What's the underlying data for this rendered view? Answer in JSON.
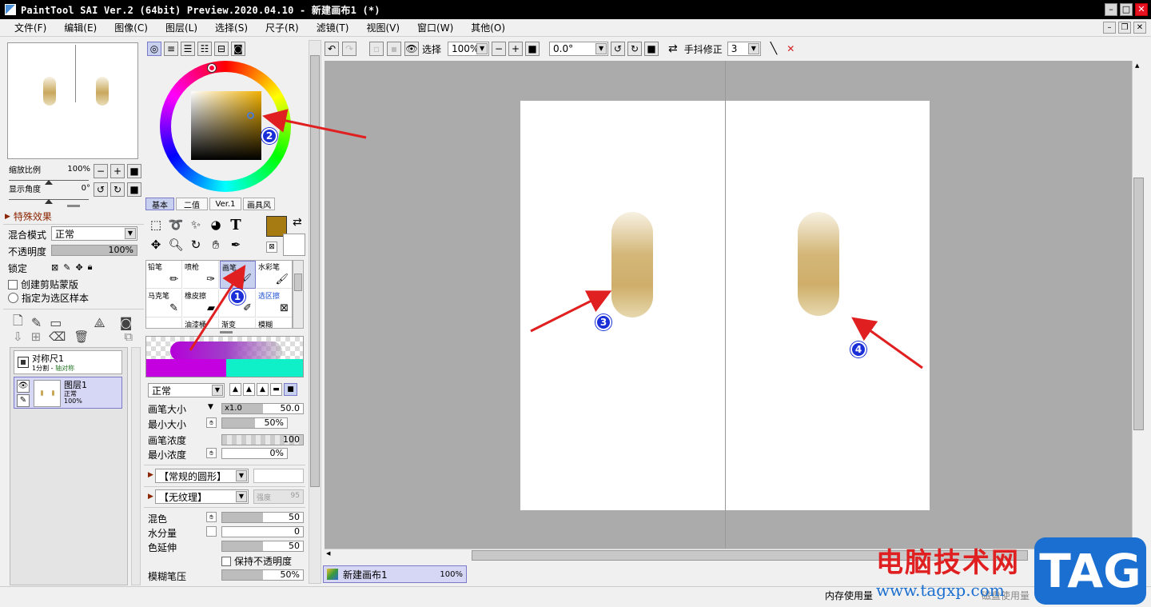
{
  "window": {
    "title": "PaintTool SAI Ver.2 (64bit) Preview.2020.04.10 - 新建画布1 (*)"
  },
  "menu": [
    "文件(F)",
    "编辑(E)",
    "图像(C)",
    "图层(L)",
    "选择(S)",
    "尺子(R)",
    "滤镜(T)",
    "视图(V)",
    "窗口(W)",
    "其他(O)"
  ],
  "navigator": {
    "zoom_label": "缩放比例",
    "zoom_value": "100%",
    "zoom_fraction": 0.5,
    "angle_label": "显示角度",
    "angle_value": "0°",
    "angle_fraction": 0.5
  },
  "effects": {
    "title": "特殊效果",
    "blend_label": "混合模式",
    "blend_value": "正常",
    "opacity_label": "不透明度",
    "opacity_value": "100%",
    "opacity_fraction": 1.0,
    "lock_label": "锁定",
    "clip_label": "创建剪贴蒙版",
    "sample_label": "指定为选区样本"
  },
  "layers": [
    {
      "name": "对称尺1",
      "sub1": "1分割",
      "sub2": "轴对称",
      "selected": false
    },
    {
      "name": "图层1",
      "mode": "正常",
      "opacity": "100%",
      "selected": true
    }
  ],
  "color": {
    "tabs": [
      "基本",
      "二值",
      "Ver.1",
      "画具风"
    ],
    "primary": "#a57b12",
    "secondary": "#ffffff"
  },
  "brushes": {
    "row1": [
      "铅笔",
      "喷枪",
      "画笔",
      "水彩笔"
    ],
    "row2": [
      "马克笔",
      "橡皮擦",
      "",
      "选区擦"
    ],
    "row3": [
      "",
      "油漆桶",
      "渐变",
      "模糊"
    ]
  },
  "brush_settings": {
    "mode": "正常",
    "size_label": "画笔大小",
    "size_mult": "x1.0",
    "size_value": "50.0",
    "size_fraction": 0.5,
    "min_size_label": "最小大小",
    "min_size_value": "50%",
    "min_size_fraction": 0.5,
    "density_label": "画笔浓度",
    "density_value": "100",
    "density_fraction": 1.0,
    "min_density_label": "最小浓度",
    "min_density_value": "0%",
    "min_density_fraction": 0.0,
    "shape": "【常规的圆形】",
    "texture": "【无纹理】",
    "texture_strength": "强度",
    "texture_value": "95",
    "blend_label": "混色",
    "blend_value": "50",
    "blend_fraction": 0.5,
    "water_label": "水分量",
    "water_value": "0",
    "water_fraction": 0.0,
    "stretch_label": "色延伸",
    "stretch_value": "50",
    "stretch_fraction": 0.5,
    "keep_opacity_label": "保持不透明度",
    "blur_label": "模糊笔压",
    "blur_value": "50%",
    "blur_fraction": 0.5
  },
  "canvas_toolbar": {
    "select_label": "选择",
    "zoom": "100%",
    "angle": "0.0°",
    "stabilizer_label": "手抖修正",
    "stabilizer_value": "3"
  },
  "document": {
    "name": "新建画布1",
    "zoom": "100%"
  },
  "status": {
    "memory_label": "内存使用量",
    "secondary_label": "磁盘使用量"
  },
  "annotations": [
    "1",
    "2",
    "3",
    "4"
  ],
  "watermark": {
    "text": "电脑技术网",
    "url": "www.tagxp.com",
    "tag": "TAG"
  }
}
